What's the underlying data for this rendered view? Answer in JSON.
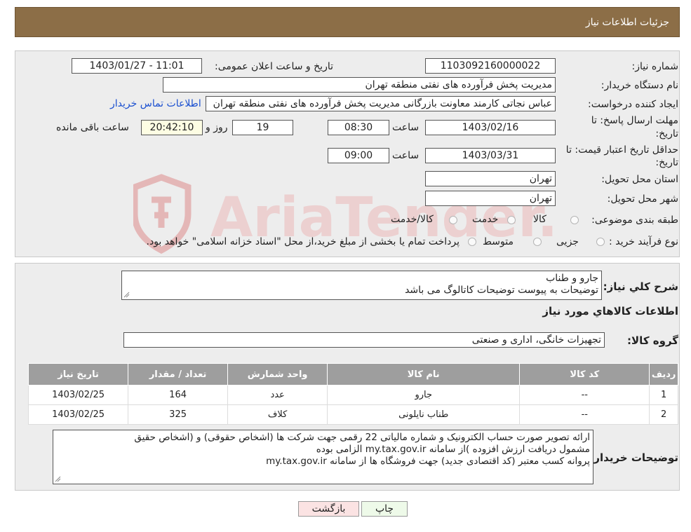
{
  "header": {
    "title": "جزئیات اطلاعات نیاز"
  },
  "form": {
    "need_number": {
      "label": "شماره نیاز:",
      "value": "1103092160000022"
    },
    "announce_datetime": {
      "label": "تاریخ و ساعت اعلان عمومی:",
      "value": "1403/01/27 - 11:01"
    },
    "buyer_org": {
      "label": "نام دستگاه خریدار:",
      "value": "مدیریت پخش فرآورده های نفتی منطقه تهران"
    },
    "requester": {
      "label": "ایجاد کننده درخواست:",
      "value": "عباس نجاتی کارمند معاونت بازرگانی مدیریت پخش فرآورده های نفتی منطقه تهران",
      "contact_link": "اطلاعات تماس خریدار"
    },
    "response_deadline": {
      "label_line1": "مهلت ارسال پاسخ: تا",
      "label_line2": "تاریخ:",
      "date": "1403/02/16",
      "time_label": "ساعت",
      "time": "08:30",
      "days": "19",
      "days_label": "روز و",
      "remaining": "20:42:10",
      "remaining_label": "ساعت باقی مانده"
    },
    "price_validity": {
      "label_line1": "حداقل تاریخ اعتبار قیمت: تا",
      "label_line2": "تاریخ:",
      "date": "1403/03/31",
      "time_label": "ساعت",
      "time": "09:00"
    },
    "delivery_province": {
      "label": "استان محل تحویل:",
      "value": "تهران"
    },
    "delivery_city": {
      "label": "شهر محل تحویل:",
      "value": "تهران"
    },
    "category": {
      "label": "طبقه بندی موضوعی:",
      "options": [
        "کالا",
        "خدمت",
        "کالا/خدمت"
      ]
    },
    "purchase_process": {
      "label": "نوع فرآیند خرید :",
      "options": [
        "جزیی",
        "متوسط"
      ],
      "note": "پرداخت تمام یا بخشی از مبلغ خرید،از محل \"اسناد خزانه اسلامی\" خواهد بود."
    }
  },
  "summary": {
    "label": "شرح کلي نياز:",
    "line1": "جارو و طناب",
    "line2": "توضیحات به پیوست توضیحات کاتالوگ می باشد"
  },
  "goods_section": {
    "title": "اطلاعات کالاهاي مورد نياز",
    "group_label": "گروه کالا:",
    "group_value": "تجهیزات خانگی، اداری و صنعتی"
  },
  "table": {
    "headers": [
      "ردیف",
      "کد کالا",
      "نام کالا",
      "واحد شمارش",
      "تعداد / مقدار",
      "تاریخ نیاز"
    ],
    "rows": [
      [
        "1",
        "--",
        "جارو",
        "عدد",
        "164",
        "1403/02/25"
      ],
      [
        "2",
        "--",
        "طناب نایلونی",
        "کلاف",
        "325",
        "1403/02/25"
      ]
    ]
  },
  "buyer_notes": {
    "label": "توضیحات خریدار:",
    "line1": "ارائه  تصویر صورت حساب الکترونیک و شماره مالیاتی 22 رقمی  جهت شرکت ها (اشخاص حقوقی) و (اشخاص حقیق",
    "line2": "مشمول دریافت ارزش افزوده )از سامانه my.tax.gov.ir  الزامی بوده",
    "line3": "پروانه کسب معتبر (کد اقتصادی جدید) جهت فروشگاه ها از سامانه my.tax.gov.ir"
  },
  "buttons": {
    "print": "چاپ",
    "back": "بازگشت"
  },
  "watermark": {
    "text": "AriaTender.neT"
  },
  "colors": {
    "header_bg": "#8c6e47",
    "panel_bg": "#ededed",
    "table_header_bg": "#9e9e9e",
    "link": "#1a4fd0",
    "print_button_bg": "#eefae9",
    "back_button_bg": "#fbe3e3",
    "watermark": "#d9a3a3"
  }
}
